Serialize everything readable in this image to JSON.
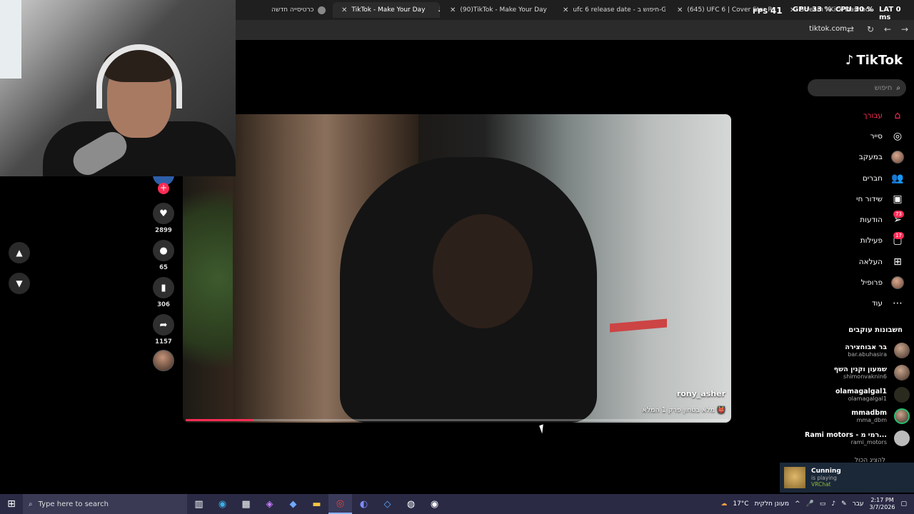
{
  "browser": {
    "tabs": [
      {
        "title": "כרטיסייה חדשה"
      },
      {
        "title": "TikTok - Make Your Day"
      },
      {
        "title": "(90)TikTok - Make Your Day"
      },
      {
        "title": "ufc 6 release date - חיפוש ב-Go"
      },
      {
        "title": "(645) UFC 6 | Cover Star Reveal"
      },
      {
        "title": "Stream - Kick Dashboard"
      }
    ],
    "address": "tiktok.com"
  },
  "overlay": {
    "fps_label": "FPS",
    "fps_value": "41",
    "gpu_label": "GPU",
    "gpu_value": "33 %",
    "cpu_label": "CPU",
    "cpu_value": "30 %",
    "lat_label": "LAT",
    "lat_value": "0 ms"
  },
  "tiktok": {
    "logo": "TikTok",
    "search_placeholder": "חיפוש",
    "nav": [
      {
        "label": "עבורך",
        "icon": "home-icon",
        "active": true
      },
      {
        "label": "סייר",
        "icon": "compass-icon"
      },
      {
        "label": "במעקב",
        "icon": "avatar-icon"
      },
      {
        "label": "חברים",
        "icon": "friends-icon"
      },
      {
        "label": "שידור חי",
        "icon": "live-icon"
      },
      {
        "label": "הודעות",
        "icon": "send-icon",
        "badge": "73"
      },
      {
        "label": "פעילות",
        "icon": "chat-icon",
        "badge": "17"
      },
      {
        "label": "העלאה",
        "icon": "plus-box-icon"
      },
      {
        "label": "פרופיל",
        "icon": "avatar-icon"
      },
      {
        "label": "עוד",
        "icon": "more-icon"
      }
    ],
    "following_title": "חשבונות עוקבים",
    "following": [
      {
        "name": "בר אבוחצירה",
        "handle": "bar.abuhasira"
      },
      {
        "name": "שמעון וקנין השף",
        "handle": "shimonvaknin6"
      },
      {
        "name": "olamagalgal1",
        "handle": "olamagalgal1"
      },
      {
        "name": "mmadbm",
        "handle": "mma_dbm"
      },
      {
        "name": "Rami motors - רמי מ...",
        "handle": "rami_motors"
      }
    ],
    "show_all": "להציג הכול"
  },
  "video": {
    "username": "rony_asher",
    "description": "מלא בטחון פרק 1 המלא 👹",
    "progress": 0.125
  },
  "actions": {
    "likes": "2899",
    "comments": "65",
    "saves": "306",
    "shares": "1157"
  },
  "notification": {
    "name": "Cunning",
    "status": "is playing",
    "game": "VRChat"
  },
  "taskbar": {
    "search_placeholder": "Type here to search",
    "weather": "17°C",
    "weather_text": "מעונן חלקית",
    "lang": "עבר",
    "time": "2:17 PM",
    "date": "3/7/2026"
  }
}
